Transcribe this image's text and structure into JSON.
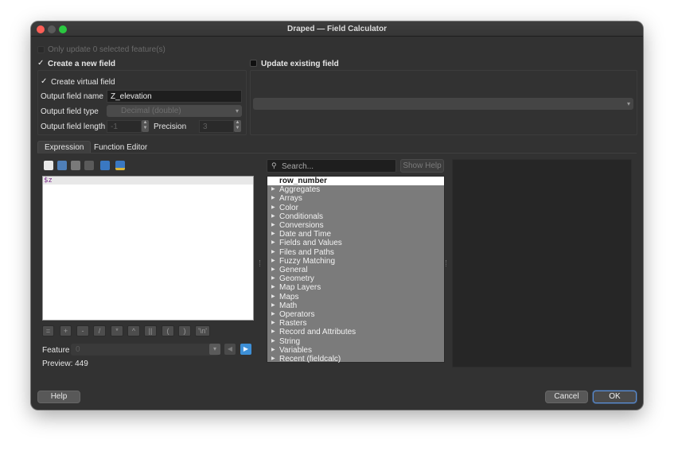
{
  "window": {
    "title": "Draped — Field Calculator"
  },
  "top": {
    "only_update_label": "Only update 0 selected feature(s)",
    "create_new_field_label": "Create a new field",
    "update_existing_label": "Update existing field"
  },
  "create": {
    "virtual_field_label": "Create virtual field",
    "output_name_label": "Output field name",
    "output_name_value": "Z_elevation",
    "output_type_label": "Output field type",
    "output_type_value": "Decimal (double)",
    "output_length_label": "Output field length",
    "output_length_value": "-1",
    "precision_label": "Precision",
    "precision_value": "3"
  },
  "tabs": [
    {
      "label": "Expression",
      "active": true
    },
    {
      "label": "Function Editor",
      "active": false
    }
  ],
  "editor": {
    "expression": "$z",
    "operators": [
      "=",
      "+",
      "-",
      "/",
      "*",
      "^",
      "||",
      "(",
      ")",
      "'\\n'"
    ],
    "feature_label": "Feature",
    "feature_value": "0",
    "preview_text": "Preview:  449"
  },
  "functions": {
    "search_placeholder": "Search...",
    "show_help_label": "Show Help",
    "items": [
      "row_number",
      "Aggregates",
      "Arrays",
      "Color",
      "Conditionals",
      "Conversions",
      "Date and Time",
      "Fields and Values",
      "Files and Paths",
      "Fuzzy Matching",
      "General",
      "Geometry",
      "Map Layers",
      "Maps",
      "Math",
      "Operators",
      "Rasters",
      "Record and Attributes",
      "String",
      "Variables",
      "Recent (fieldcalc)"
    ]
  },
  "footer": {
    "help_label": "Help",
    "cancel_label": "Cancel",
    "ok_label": "OK"
  },
  "icons": {
    "toolbar": [
      "new-file-icon",
      "save-icon",
      "save-as-icon",
      "delete-icon",
      "import-icon",
      "export-icon"
    ]
  },
  "colors": {
    "window_bg": "#323232",
    "function_list_bg": "#7b7b7b",
    "ok_border": "#5a8fd8",
    "nav_next": "#3d8fd6"
  }
}
